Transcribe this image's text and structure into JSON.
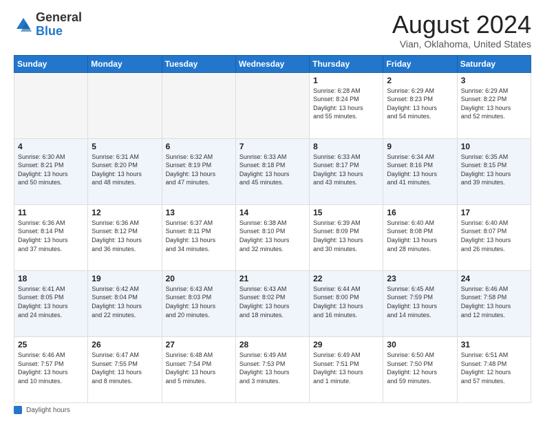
{
  "logo": {
    "general": "General",
    "blue": "Blue"
  },
  "header": {
    "title": "August 2024",
    "location": "Vian, Oklahoma, United States"
  },
  "weekdays": [
    "Sunday",
    "Monday",
    "Tuesday",
    "Wednesday",
    "Thursday",
    "Friday",
    "Saturday"
  ],
  "footer": {
    "daylight_label": "Daylight hours"
  },
  "weeks": [
    [
      {
        "day": "",
        "info": ""
      },
      {
        "day": "",
        "info": ""
      },
      {
        "day": "",
        "info": ""
      },
      {
        "day": "",
        "info": ""
      },
      {
        "day": "1",
        "info": "Sunrise: 6:28 AM\nSunset: 8:24 PM\nDaylight: 13 hours\nand 55 minutes."
      },
      {
        "day": "2",
        "info": "Sunrise: 6:29 AM\nSunset: 8:23 PM\nDaylight: 13 hours\nand 54 minutes."
      },
      {
        "day": "3",
        "info": "Sunrise: 6:29 AM\nSunset: 8:22 PM\nDaylight: 13 hours\nand 52 minutes."
      }
    ],
    [
      {
        "day": "4",
        "info": "Sunrise: 6:30 AM\nSunset: 8:21 PM\nDaylight: 13 hours\nand 50 minutes."
      },
      {
        "day": "5",
        "info": "Sunrise: 6:31 AM\nSunset: 8:20 PM\nDaylight: 13 hours\nand 48 minutes."
      },
      {
        "day": "6",
        "info": "Sunrise: 6:32 AM\nSunset: 8:19 PM\nDaylight: 13 hours\nand 47 minutes."
      },
      {
        "day": "7",
        "info": "Sunrise: 6:33 AM\nSunset: 8:18 PM\nDaylight: 13 hours\nand 45 minutes."
      },
      {
        "day": "8",
        "info": "Sunrise: 6:33 AM\nSunset: 8:17 PM\nDaylight: 13 hours\nand 43 minutes."
      },
      {
        "day": "9",
        "info": "Sunrise: 6:34 AM\nSunset: 8:16 PM\nDaylight: 13 hours\nand 41 minutes."
      },
      {
        "day": "10",
        "info": "Sunrise: 6:35 AM\nSunset: 8:15 PM\nDaylight: 13 hours\nand 39 minutes."
      }
    ],
    [
      {
        "day": "11",
        "info": "Sunrise: 6:36 AM\nSunset: 8:14 PM\nDaylight: 13 hours\nand 37 minutes."
      },
      {
        "day": "12",
        "info": "Sunrise: 6:36 AM\nSunset: 8:12 PM\nDaylight: 13 hours\nand 36 minutes."
      },
      {
        "day": "13",
        "info": "Sunrise: 6:37 AM\nSunset: 8:11 PM\nDaylight: 13 hours\nand 34 minutes."
      },
      {
        "day": "14",
        "info": "Sunrise: 6:38 AM\nSunset: 8:10 PM\nDaylight: 13 hours\nand 32 minutes."
      },
      {
        "day": "15",
        "info": "Sunrise: 6:39 AM\nSunset: 8:09 PM\nDaylight: 13 hours\nand 30 minutes."
      },
      {
        "day": "16",
        "info": "Sunrise: 6:40 AM\nSunset: 8:08 PM\nDaylight: 13 hours\nand 28 minutes."
      },
      {
        "day": "17",
        "info": "Sunrise: 6:40 AM\nSunset: 8:07 PM\nDaylight: 13 hours\nand 26 minutes."
      }
    ],
    [
      {
        "day": "18",
        "info": "Sunrise: 6:41 AM\nSunset: 8:05 PM\nDaylight: 13 hours\nand 24 minutes."
      },
      {
        "day": "19",
        "info": "Sunrise: 6:42 AM\nSunset: 8:04 PM\nDaylight: 13 hours\nand 22 minutes."
      },
      {
        "day": "20",
        "info": "Sunrise: 6:43 AM\nSunset: 8:03 PM\nDaylight: 13 hours\nand 20 minutes."
      },
      {
        "day": "21",
        "info": "Sunrise: 6:43 AM\nSunset: 8:02 PM\nDaylight: 13 hours\nand 18 minutes."
      },
      {
        "day": "22",
        "info": "Sunrise: 6:44 AM\nSunset: 8:00 PM\nDaylight: 13 hours\nand 16 minutes."
      },
      {
        "day": "23",
        "info": "Sunrise: 6:45 AM\nSunset: 7:59 PM\nDaylight: 13 hours\nand 14 minutes."
      },
      {
        "day": "24",
        "info": "Sunrise: 6:46 AM\nSunset: 7:58 PM\nDaylight: 13 hours\nand 12 minutes."
      }
    ],
    [
      {
        "day": "25",
        "info": "Sunrise: 6:46 AM\nSunset: 7:57 PM\nDaylight: 13 hours\nand 10 minutes."
      },
      {
        "day": "26",
        "info": "Sunrise: 6:47 AM\nSunset: 7:55 PM\nDaylight: 13 hours\nand 8 minutes."
      },
      {
        "day": "27",
        "info": "Sunrise: 6:48 AM\nSunset: 7:54 PM\nDaylight: 13 hours\nand 5 minutes."
      },
      {
        "day": "28",
        "info": "Sunrise: 6:49 AM\nSunset: 7:53 PM\nDaylight: 13 hours\nand 3 minutes."
      },
      {
        "day": "29",
        "info": "Sunrise: 6:49 AM\nSunset: 7:51 PM\nDaylight: 13 hours\nand 1 minute."
      },
      {
        "day": "30",
        "info": "Sunrise: 6:50 AM\nSunset: 7:50 PM\nDaylight: 12 hours\nand 59 minutes."
      },
      {
        "day": "31",
        "info": "Sunrise: 6:51 AM\nSunset: 7:48 PM\nDaylight: 12 hours\nand 57 minutes."
      }
    ]
  ]
}
